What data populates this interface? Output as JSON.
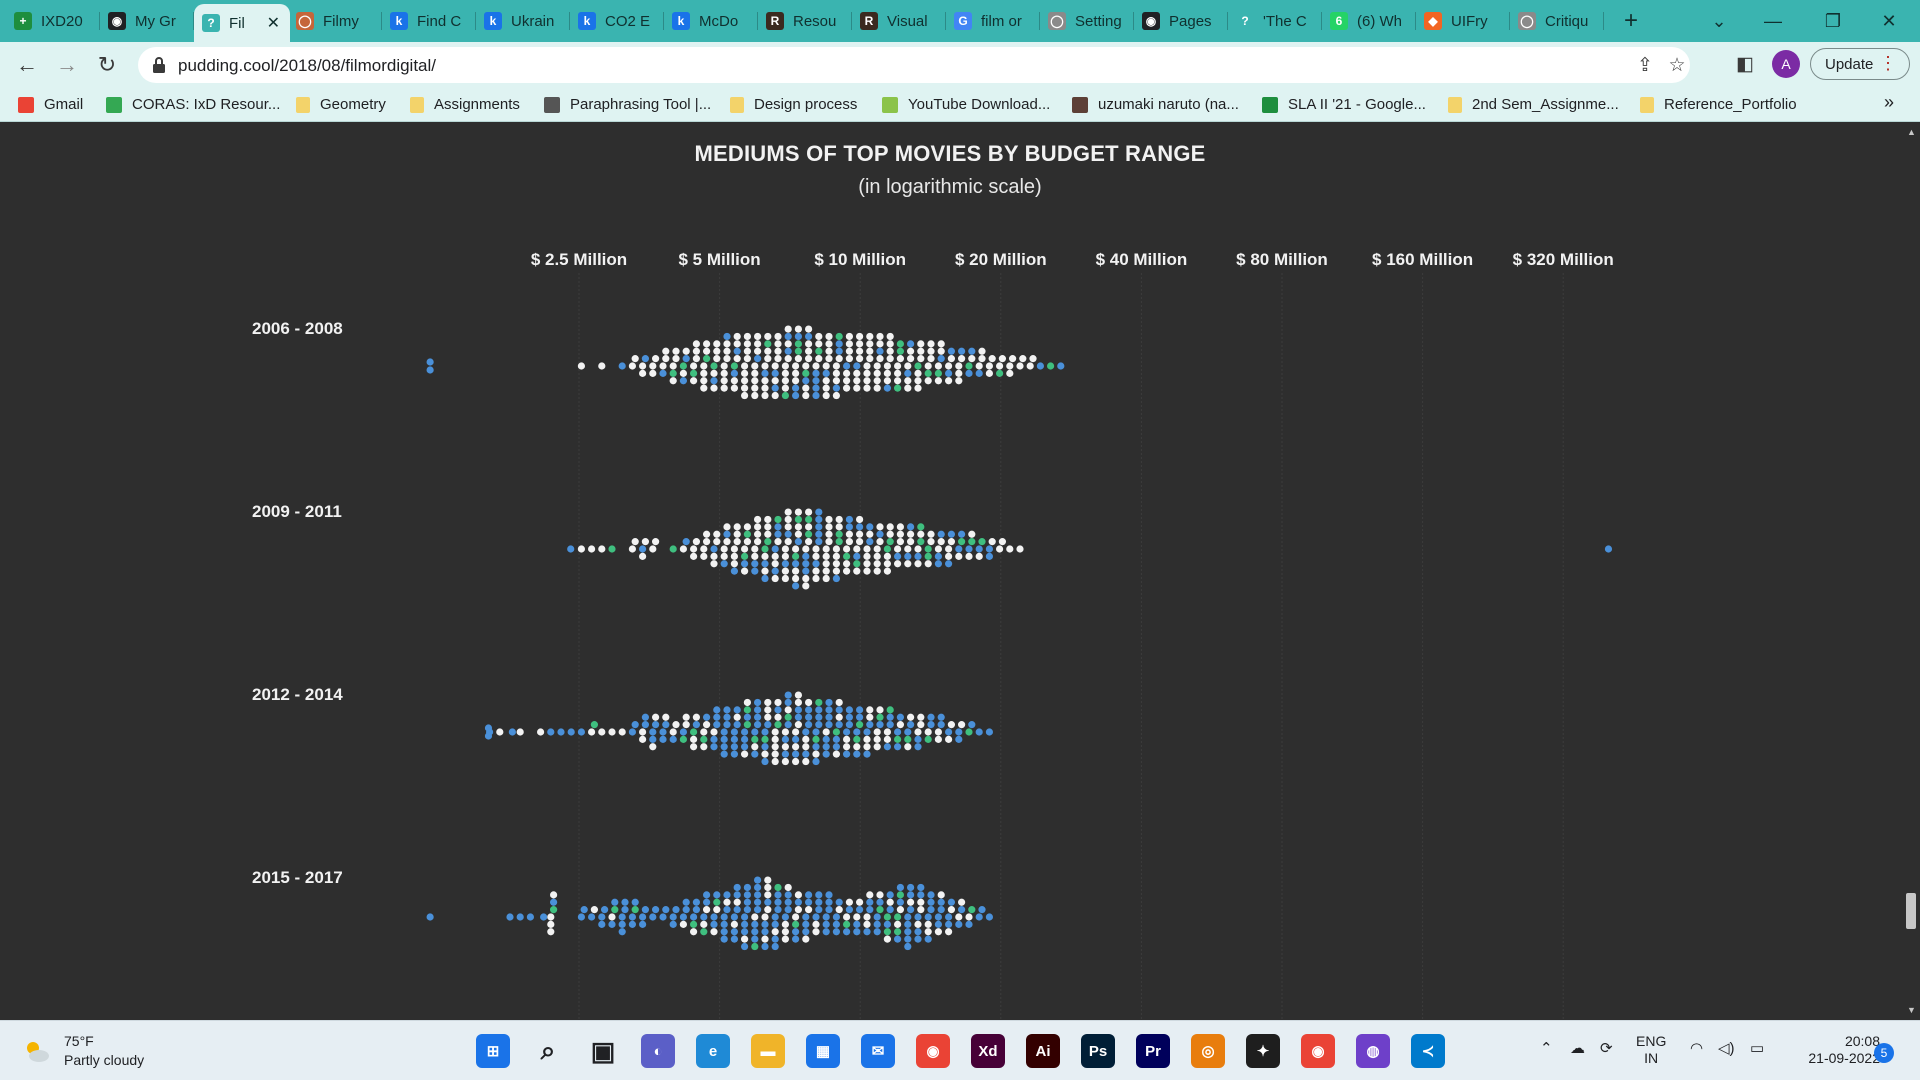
{
  "browser": {
    "tabs": [
      {
        "title": "IXD20",
        "color": "#1e8e3e",
        "glyph": "+"
      },
      {
        "title": "My Gr",
        "color": "#202124",
        "glyph": "◉"
      },
      {
        "title": "Fil",
        "color": "#3ab4b0",
        "glyph": "?"
      },
      {
        "title": "Filmy",
        "color": "#c5663a",
        "glyph": "◯"
      },
      {
        "title": "Find C",
        "color": "#1a73e8",
        "glyph": "k"
      },
      {
        "title": "Ukrain",
        "color": "#1a73e8",
        "glyph": "k"
      },
      {
        "title": "CO2 E",
        "color": "#1a73e8",
        "glyph": "k"
      },
      {
        "title": "McDo",
        "color": "#1a73e8",
        "glyph": "k"
      },
      {
        "title": "Resou",
        "color": "#3b2a1f",
        "glyph": "R"
      },
      {
        "title": "Visual",
        "color": "#3b2a1f",
        "glyph": "R"
      },
      {
        "title": "film or",
        "color": "#4285f4",
        "glyph": "G"
      },
      {
        "title": "Setting",
        "color": "#8a8a8a",
        "glyph": "◯"
      },
      {
        "title": "Pages",
        "color": "#202124",
        "glyph": "◉"
      },
      {
        "title": "'The C",
        "color": "#3ab4b0",
        "glyph": "?"
      },
      {
        "title": "(6) Wh",
        "color": "#25d366",
        "glyph": "6"
      },
      {
        "title": "UIFry",
        "color": "#f26522",
        "glyph": "◆"
      },
      {
        "title": "Critiqu",
        "color": "#8a8a8a",
        "glyph": "◯"
      }
    ],
    "new_tab": "+",
    "url": "pudding.cool/2018/08/filmordigital/",
    "profile_initial": "A",
    "update_label": "Update",
    "bookmarks": [
      {
        "label": "Gmail",
        "kind": "gmail"
      },
      {
        "label": "CORAS: IxD Resour...",
        "kind": "coras"
      },
      {
        "label": "Geometry",
        "kind": "folder"
      },
      {
        "label": "Assignments",
        "kind": "folder"
      },
      {
        "label": "Paraphrasing Tool |...",
        "kind": "quill"
      },
      {
        "label": "Design process",
        "kind": "folder"
      },
      {
        "label": "YouTube Download...",
        "kind": "android"
      },
      {
        "label": "uzumaki naruto (na...",
        "kind": "box"
      },
      {
        "label": "SLA II '21 - Google...",
        "kind": "sheets"
      },
      {
        "label": "2nd Sem_Assignme...",
        "kind": "folder"
      },
      {
        "label": "Reference_Portfolio",
        "kind": "folder"
      }
    ],
    "bookmarks_more": "»"
  },
  "chart_data": {
    "type": "scatter",
    "title": "MEDIUMS OF TOP MOVIES BY BUDGET RANGE",
    "subtitle": "(in logarithmic scale)",
    "x_scale": "log2",
    "x_unit": "USD",
    "x_ticks": [
      {
        "value": 2500000,
        "label": "$ 2.5 Million"
      },
      {
        "value": 5000000,
        "label": "$ 5 Million"
      },
      {
        "value": 10000000,
        "label": "$ 10 Million"
      },
      {
        "value": 20000000,
        "label": "$ 20 Million"
      },
      {
        "value": 40000000,
        "label": "$ 40 Million"
      },
      {
        "value": 80000000,
        "label": "$ 80 Million"
      },
      {
        "value": 160000000,
        "label": "$ 160 Million"
      },
      {
        "value": 320000000,
        "label": "$ 320 Million"
      }
    ],
    "series_colors": {
      "film": "#f2f2f2",
      "digital": "#4a90d9",
      "both": "#3fbf7f"
    },
    "rows": [
      {
        "label": "2006 - 2008",
        "counts_per_bin": [
          0,
          0,
          0,
          0,
          0,
          0,
          0,
          0,
          0,
          0,
          0,
          0,
          0,
          0,
          0,
          0,
          0,
          0,
          0,
          1,
          0,
          1,
          0,
          1,
          2,
          3,
          3,
          4,
          5,
          5,
          6,
          7,
          7,
          8,
          8,
          9,
          9,
          9,
          9,
          10,
          10,
          10,
          9,
          9,
          9,
          8,
          8,
          8,
          8,
          8,
          7,
          7,
          7,
          6,
          6,
          5,
          5,
          4,
          4,
          3,
          3,
          3,
          2,
          2,
          1,
          1,
          1,
          0,
          0,
          0
        ],
        "digital_share": 0.14,
        "both_share": 0.09,
        "outliers": [
          {
            "budget": 1200000,
            "count": 2,
            "medium": "digital"
          }
        ]
      },
      {
        "label": "2009 - 2011",
        "counts_per_bin": [
          0,
          0,
          0,
          0,
          0,
          0,
          0,
          0,
          0,
          0,
          0,
          0,
          0,
          0,
          0,
          0,
          0,
          0,
          0,
          1,
          1,
          1,
          1,
          0,
          2,
          3,
          2,
          0,
          1,
          2,
          3,
          4,
          5,
          6,
          7,
          7,
          8,
          9,
          9,
          10,
          11,
          11,
          10,
          9,
          9,
          8,
          8,
          7,
          7,
          7,
          6,
          6,
          6,
          5,
          5,
          5,
          4,
          4,
          3,
          3,
          2,
          1,
          1,
          0,
          0,
          0,
          0,
          0,
          0,
          0
        ],
        "digital_share": 0.22,
        "both_share": 0.09,
        "outliers": [
          {
            "budget": 2400000,
            "count": 1,
            "medium": "digital"
          },
          {
            "budget": 400000000,
            "count": 1,
            "medium": "digital"
          }
        ]
      },
      {
        "label": "2012 - 2014",
        "counts_per_bin": [
          0,
          0,
          0,
          0,
          0,
          0,
          0,
          0,
          0,
          0,
          1,
          1,
          0,
          1,
          0,
          1,
          1,
          1,
          1,
          1,
          2,
          1,
          1,
          1,
          2,
          4,
          5,
          4,
          3,
          4,
          5,
          5,
          6,
          7,
          7,
          8,
          8,
          9,
          9,
          10,
          10,
          9,
          9,
          8,
          8,
          7,
          7,
          7,
          6,
          6,
          5,
          5,
          5,
          4,
          4,
          3,
          3,
          2,
          1,
          1,
          0,
          0,
          0,
          0,
          0,
          0,
          0,
          0,
          0,
          0
        ],
        "digital_share": 0.55,
        "both_share": 0.1,
        "outliers": [
          {
            "budget": 1600000,
            "count": 2,
            "medium": "digital"
          },
          {
            "budget": 1800000,
            "count": 1,
            "medium": "digital"
          }
        ]
      },
      {
        "label": "2015 - 2017",
        "counts_per_bin": [
          0,
          0,
          0,
          0,
          0,
          0,
          0,
          0,
          0,
          0,
          0,
          0,
          1,
          1,
          1,
          0,
          6,
          0,
          0,
          2,
          2,
          3,
          4,
          5,
          4,
          3,
          2,
          2,
          3,
          4,
          5,
          6,
          6,
          7,
          8,
          9,
          10,
          10,
          9,
          8,
          7,
          7,
          6,
          6,
          5,
          5,
          5,
          6,
          6,
          7,
          8,
          9,
          8,
          7,
          6,
          5,
          4,
          3,
          2,
          1,
          0,
          0,
          0,
          0,
          0,
          0,
          0,
          0,
          0,
          0
        ],
        "digital_share": 0.7,
        "both_share": 0.07,
        "outliers": [
          {
            "budget": 1200000,
            "count": 1,
            "medium": "digital"
          },
          {
            "budget": 2100000,
            "count": 1,
            "medium": "digital"
          }
        ]
      }
    ]
  },
  "taskbar": {
    "weather_temp": "75°F",
    "weather_desc": "Partly cloudy",
    "lang_top": "ENG",
    "lang_bottom": "IN",
    "time": "20:08",
    "date": "21-09-2022",
    "notifications": "5",
    "apps": [
      {
        "name": "windows-start",
        "color": "#1a73e8",
        "glyph": "⊞"
      },
      {
        "name": "search",
        "color": "#202124",
        "glyph": "⌕"
      },
      {
        "name": "task-view",
        "color": "#202124",
        "glyph": "▣"
      },
      {
        "name": "teams-chat",
        "color": "#5b5fc7",
        "glyph": "◐"
      },
      {
        "name": "edge",
        "color": "#1f8ad6",
        "glyph": "e"
      },
      {
        "name": "file-explorer",
        "color": "#f0b429",
        "glyph": "▬"
      },
      {
        "name": "store",
        "color": "#1a73e8",
        "glyph": "▦"
      },
      {
        "name": "mail",
        "color": "#1a73e8",
        "glyph": "✉"
      },
      {
        "name": "chrome",
        "color": "#ea4335",
        "glyph": "◉"
      },
      {
        "name": "adobe-xd",
        "color": "#470137",
        "glyph": "Xd"
      },
      {
        "name": "illustrator",
        "color": "#330000",
        "glyph": "Ai"
      },
      {
        "name": "photoshop",
        "color": "#001e36",
        "glyph": "Ps"
      },
      {
        "name": "premiere",
        "color": "#00005b",
        "glyph": "Pr"
      },
      {
        "name": "blender",
        "color": "#e87d0d",
        "glyph": "◎"
      },
      {
        "name": "figma",
        "color": "#1e1e1e",
        "glyph": "✦"
      },
      {
        "name": "chrome-profile",
        "color": "#ea4335",
        "glyph": "◉"
      },
      {
        "name": "github-desktop",
        "color": "#6e40c9",
        "glyph": "◍"
      },
      {
        "name": "vscode",
        "color": "#007acc",
        "glyph": "≺"
      }
    ]
  }
}
